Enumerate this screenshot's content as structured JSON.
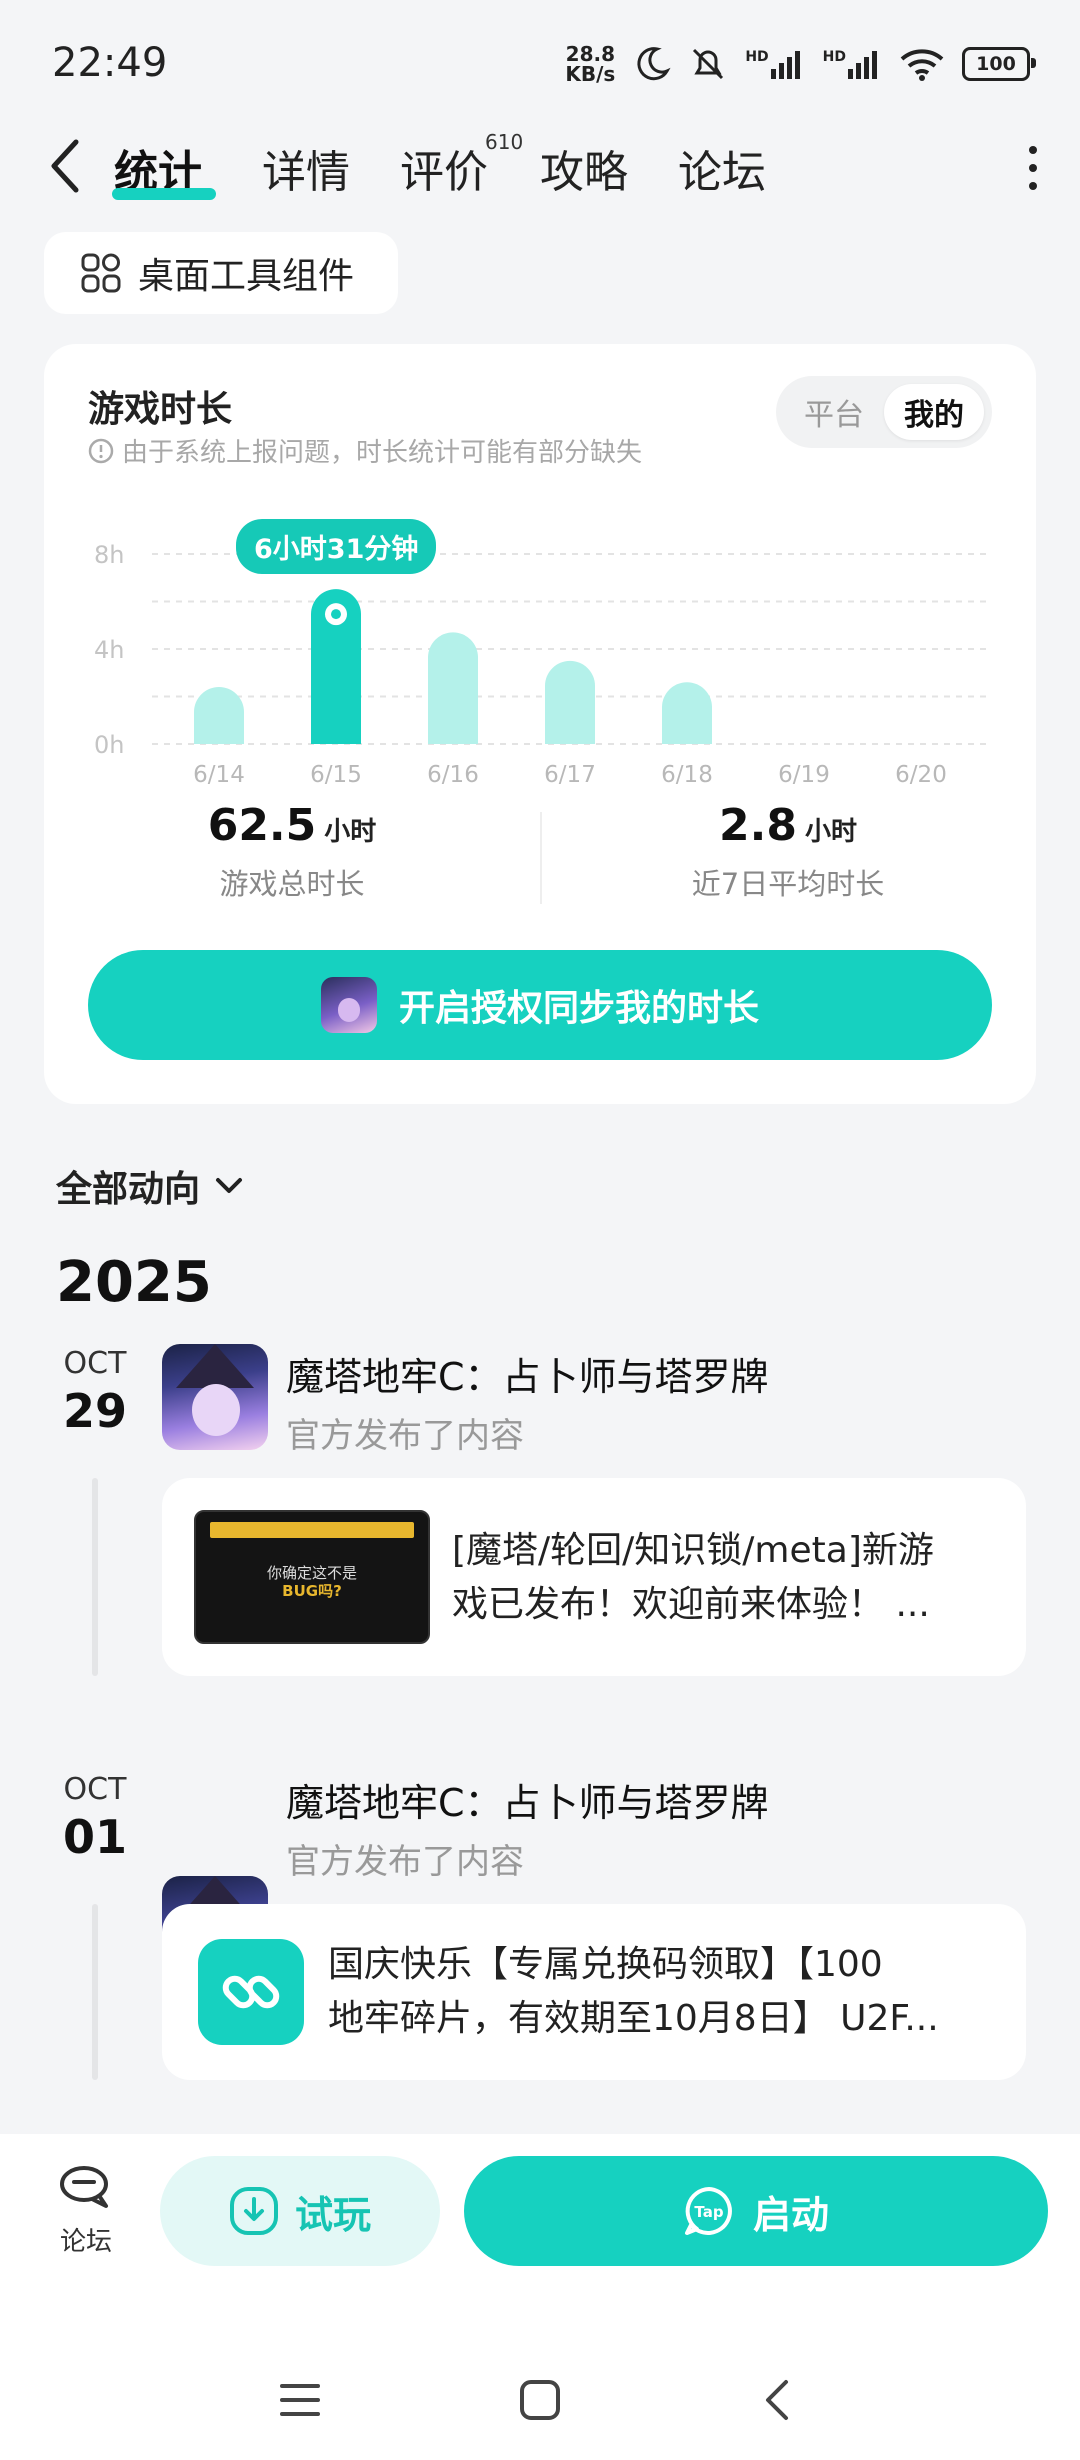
{
  "status_bar": {
    "time": "22:49",
    "net_speed_value": "28.8",
    "net_speed_unit": "KB/s",
    "network_1": "HD",
    "network_2": "HD",
    "battery": "100",
    "icons": [
      "moon-icon",
      "mute-bell-icon",
      "signal-icon",
      "signal-icon",
      "wifi-icon",
      "battery-icon"
    ]
  },
  "nav": {
    "tabs": [
      {
        "label": "统计",
        "active": true
      },
      {
        "label": "详情",
        "active": false
      },
      {
        "label": "评价",
        "badge": "610",
        "active": false
      },
      {
        "label": "攻略",
        "active": false
      },
      {
        "label": "论坛",
        "active": false
      }
    ]
  },
  "widget_button": {
    "label": "桌面工具组件"
  },
  "stats_card": {
    "title": "游戏时长",
    "note": "由于系统上报问题，时长统计可能有部分缺失",
    "toggle": {
      "options": [
        "平台",
        "我的"
      ],
      "selected": "我的"
    },
    "tooltip": "6小时31分钟",
    "total_value": "62.5",
    "total_unit": "小时",
    "total_label": "游戏总时长",
    "avg_value": "2.8",
    "avg_unit": "小时",
    "avg_label": "近7日平均时长",
    "sync_button": "开启授权同步我的时长",
    "accent": "#16d1c0"
  },
  "chart_data": {
    "type": "bar",
    "categories": [
      "6/14",
      "6/15",
      "6/16",
      "6/17",
      "6/18",
      "6/19",
      "6/20"
    ],
    "values": [
      2.4,
      6.52,
      4.7,
      3.5,
      2.6,
      0,
      0
    ],
    "highlighted_index": 1,
    "y_ticks": [
      "8h",
      "4h",
      "0h"
    ],
    "ylim": [
      0,
      8
    ],
    "grid": true
  },
  "feed": {
    "filter_label": "全部动向",
    "year": "2025",
    "items": [
      {
        "month": "OCT",
        "day": "29",
        "title": "魔塔地牢C：占卜师与塔罗牌",
        "subtitle": "官方发布了内容",
        "post_line1": "[魔塔/轮回/知识锁/meta]新游",
        "post_line2": "戏已发布！欢迎前来体验！ ...",
        "thumb_line1": "你确定这不是",
        "thumb_line2": "BUG吗?"
      },
      {
        "month": "OCT",
        "day": "01",
        "title": "魔塔地牢C：占卜师与塔罗牌",
        "subtitle": "官方发布了内容",
        "post_line1": "国庆快乐【专属兑换码领取】【100",
        "post_line2": "地牢碎片，有效期至10月8日】 U2F..."
      }
    ]
  },
  "bottom_bar": {
    "forum_label": "论坛",
    "try_label": "试玩",
    "launch_label": "启动",
    "launch_icon_text": "Tap"
  }
}
